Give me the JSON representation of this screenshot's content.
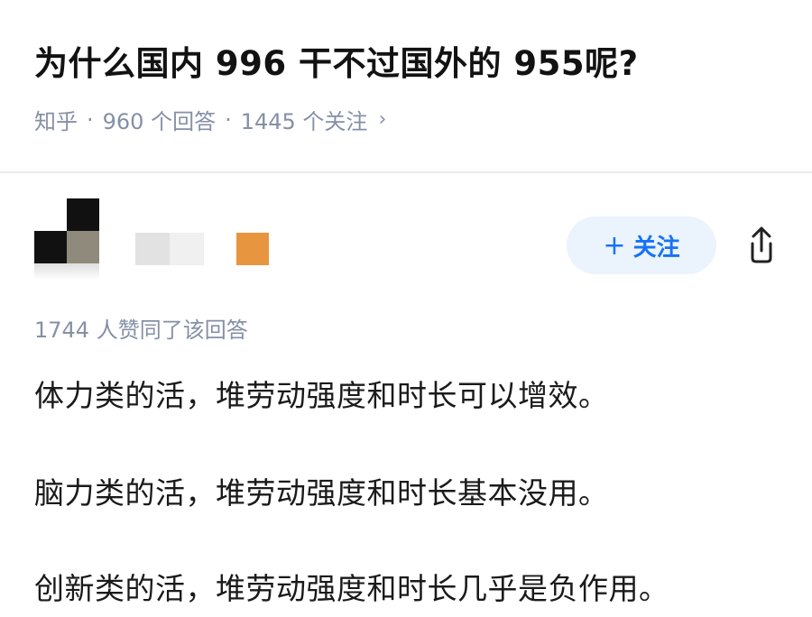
{
  "question": {
    "title": "为什么国内 996 干不过国外的 955呢?"
  },
  "meta": {
    "site": "知乎",
    "separator": "·",
    "answers": "960 个回答",
    "followers": "1445 个关注",
    "chevron": "›"
  },
  "author": {
    "badge_color": "#e8953f"
  },
  "actions": {
    "follow_plus": "+",
    "follow_label": "关注",
    "follow_color": "#1772f6",
    "share_icon": "share-icon"
  },
  "answer": {
    "upvotes": "1744 人赞同了该回答",
    "paragraphs": [
      "体力类的活，堆劳动强度和时长可以增效。",
      "脑力类的活，堆劳动强度和时长基本没用。",
      "创新类的活，堆劳动强度和时长几乎是负作用。"
    ]
  }
}
